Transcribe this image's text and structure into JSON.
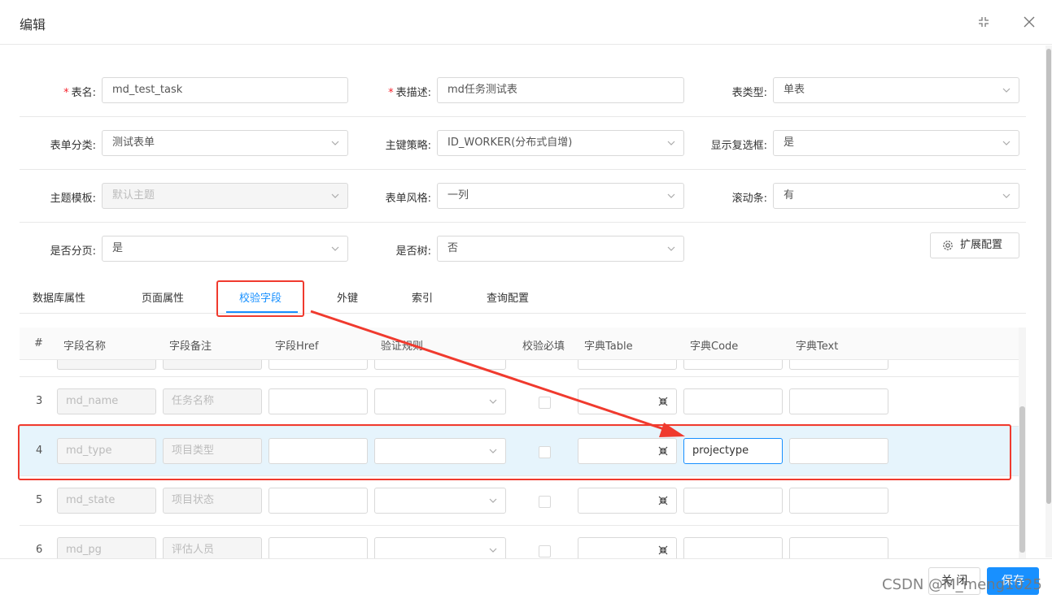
{
  "dialog": {
    "title": "编辑"
  },
  "form": {
    "table_name": {
      "label": "表名:",
      "value": "md_test_task"
    },
    "table_desc": {
      "label": "表描述:",
      "value": "md任务测试表"
    },
    "table_type": {
      "label": "表类型:",
      "value": "单表"
    },
    "form_category": {
      "label": "表单分类:",
      "value": "测试表单"
    },
    "pk_strategy": {
      "label": "主键策略:",
      "value": "ID_WORKER(分布式自增)"
    },
    "show_checkbox": {
      "label": "显示复选框:",
      "value": "是"
    },
    "theme_template": {
      "label": "主题模板:",
      "value": "默认主题"
    },
    "form_style": {
      "label": "表单风格:",
      "value": "一列"
    },
    "scrollbar": {
      "label": "滚动条:",
      "value": "有"
    },
    "paging": {
      "label": "是否分页:",
      "value": "是"
    },
    "is_tree": {
      "label": "是否树:",
      "value": "否"
    },
    "required_mark": "*",
    "ext_button": "扩展配置"
  },
  "tabs": [
    "数据库属性",
    "页面属性",
    "校验字段",
    "外键",
    "索引",
    "查询配置"
  ],
  "table": {
    "headers": [
      "#",
      "字段名称",
      "字段备注",
      "字段Href",
      "验证规则",
      "校验必填",
      "字典Table",
      "字典Code",
      "字典Text"
    ],
    "rows": [
      {
        "num": "3",
        "name": "md_name",
        "note": "任务名称",
        "href": "",
        "dict_code": ""
      },
      {
        "num": "4",
        "name": "md_type",
        "note": "项目类型",
        "href": "",
        "dict_code": "projectype"
      },
      {
        "num": "5",
        "name": "md_state",
        "note": "项目状态",
        "href": "",
        "dict_code": ""
      },
      {
        "num": "6",
        "name": "md_pg",
        "note": "评估人员",
        "href": "",
        "dict_code": ""
      }
    ]
  },
  "footer": {
    "close": "关 闭",
    "save": "保存"
  },
  "watermark": "CSDN @M_meng1025",
  "colors": {
    "accent": "#1890ff",
    "annotation": "#f03a2e",
    "highlight_row": "#e6f4fc"
  }
}
